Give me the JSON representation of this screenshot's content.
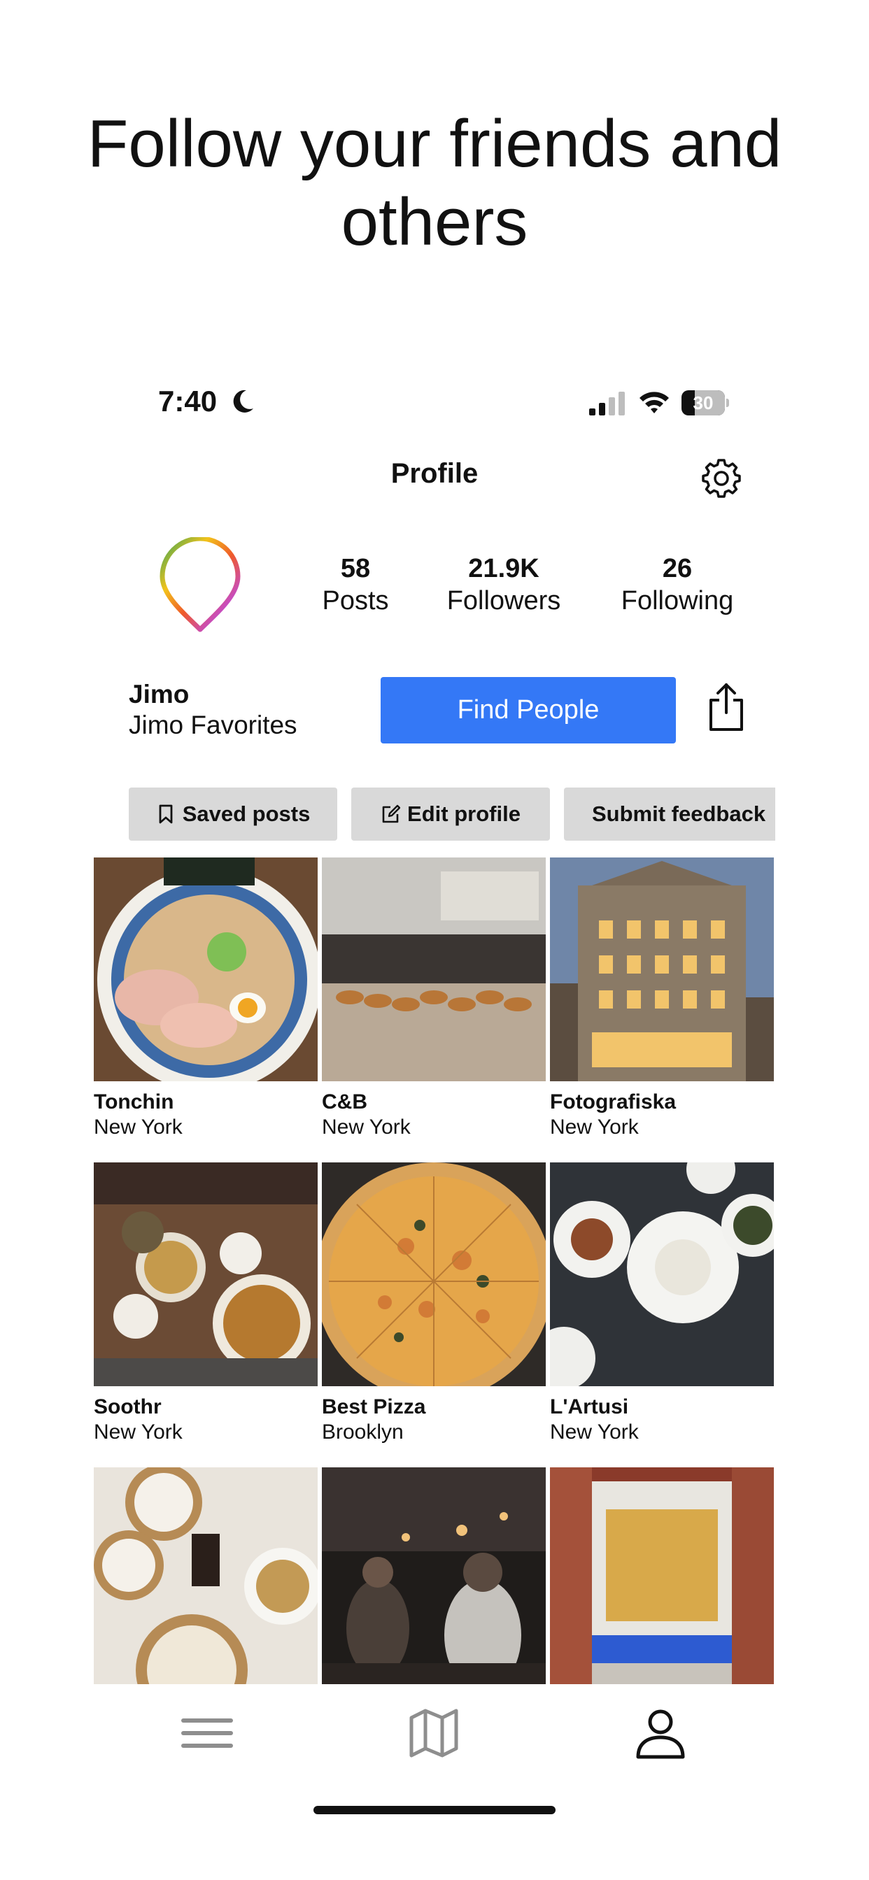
{
  "headline": "Follow your friends and others",
  "status_bar": {
    "time": "7:40",
    "battery_level": "30",
    "battery_fraction": 0.3
  },
  "nav": {
    "title": "Profile"
  },
  "stats": {
    "posts": {
      "value": "58",
      "label": "Posts"
    },
    "followers": {
      "value": "21.9K",
      "label": "Followers"
    },
    "following": {
      "value": "26",
      "label": "Following"
    }
  },
  "profile": {
    "name": "Jimo",
    "subtitle": "Jimo Favorites",
    "find_people_label": "Find People"
  },
  "chips": {
    "saved": "Saved posts",
    "edit": "Edit profile",
    "feedback": "Submit feedback"
  },
  "places": [
    {
      "name": "Tonchin",
      "city": "New York"
    },
    {
      "name": "C&B",
      "city": "New York"
    },
    {
      "name": "Fotografiska",
      "city": "New York"
    },
    {
      "name": "Soothr",
      "city": "New York"
    },
    {
      "name": "Best Pizza",
      "city": "Brooklyn"
    },
    {
      "name": "L'Artusi",
      "city": "New York"
    },
    {
      "name": "",
      "city": ""
    },
    {
      "name": "",
      "city": ""
    },
    {
      "name": "",
      "city": ""
    }
  ],
  "colors": {
    "accent": "#3478f6",
    "chip_bg": "#d9d9d9",
    "text": "#111111",
    "inactive_icon": "#8e8e8e"
  },
  "icons": {
    "moon": "moon-icon",
    "signal": "signal-icon",
    "wifi": "wifi-icon",
    "gear": "gear-icon",
    "share": "share-icon",
    "bookmark": "bookmark-icon",
    "edit": "edit-icon",
    "tab_feed": "list-icon",
    "tab_map": "map-icon",
    "tab_profile": "person-icon"
  }
}
